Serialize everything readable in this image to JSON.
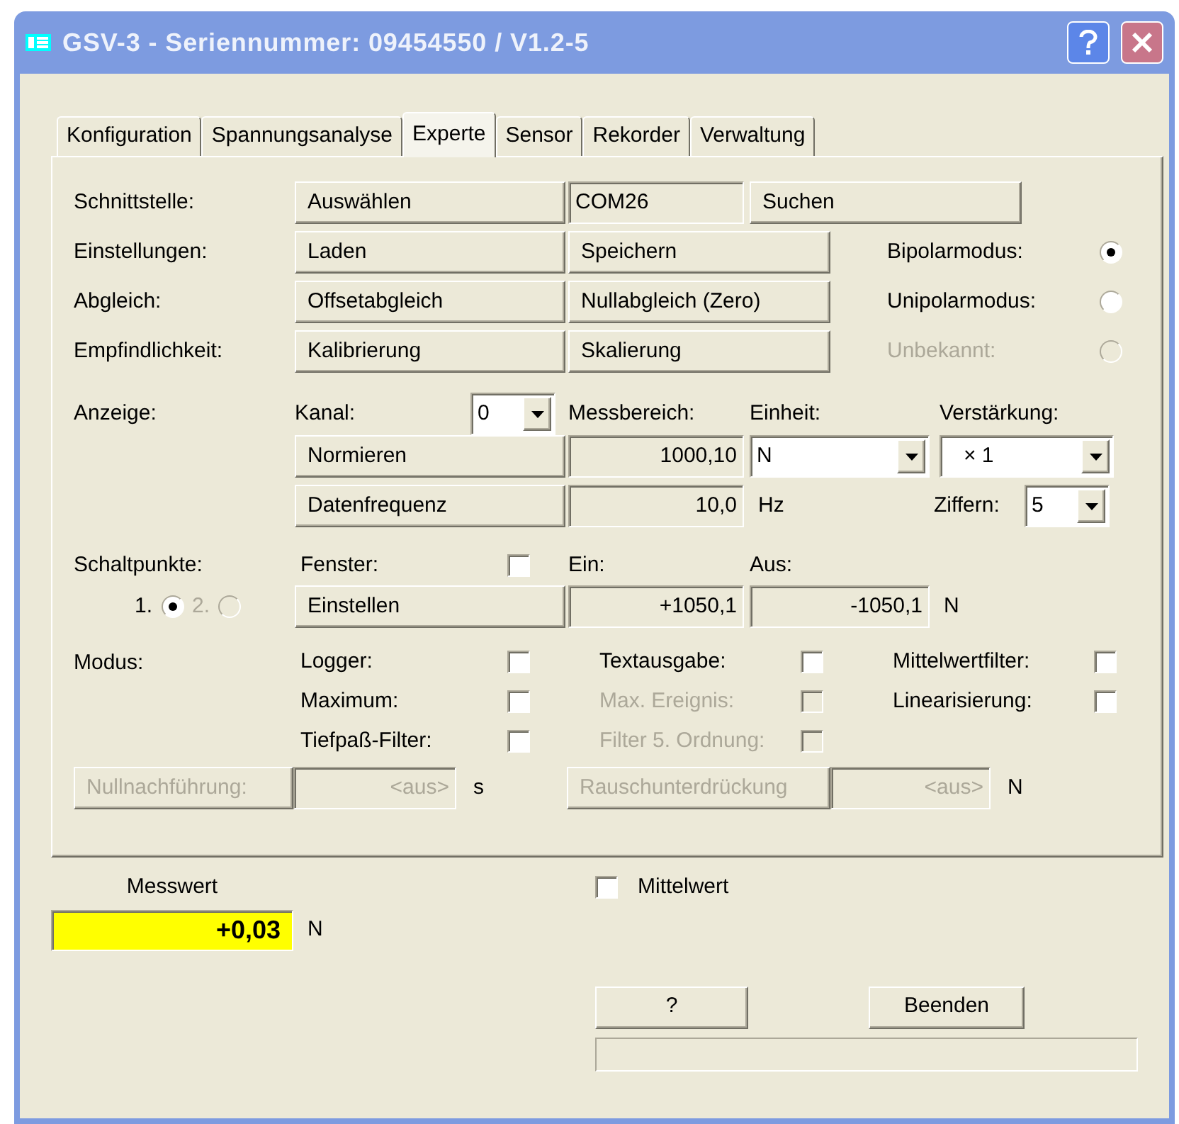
{
  "window": {
    "title": "GSV-3 - Seriennummer: 09454550 / V1.2-5"
  },
  "tabs": [
    {
      "label": "Konfiguration",
      "selected": false
    },
    {
      "label": "Spannungsanalyse",
      "selected": false
    },
    {
      "label": "Experte",
      "selected": true
    },
    {
      "label": "Sensor",
      "selected": false
    },
    {
      "label": "Rekorder",
      "selected": false
    },
    {
      "label": "Verwaltung",
      "selected": false
    }
  ],
  "interface": {
    "label": "Schnittstelle:",
    "select_button": "Auswählen",
    "port": "COM26",
    "search_button": "Suchen"
  },
  "button_rows": [
    {
      "label": "Einstellungen:",
      "buttons": [
        "Laden",
        "Speichern"
      ]
    },
    {
      "label": "Abgleich:",
      "buttons": [
        "Offsetabgleich",
        "Nullabgleich (Zero)"
      ]
    },
    {
      "label": "Empfindlichkeit:",
      "buttons": [
        "Kalibrierung",
        "Skalierung"
      ]
    }
  ],
  "modes": [
    {
      "label": "Bipolarmodus:",
      "selected": true,
      "disabled": false
    },
    {
      "label": "Unipolarmodus:",
      "selected": false,
      "disabled": false
    },
    {
      "label": "Unbekannt:",
      "selected": false,
      "disabled": true
    }
  ],
  "display": {
    "label": "Anzeige:",
    "channel_label": "Kanal:",
    "channel": "0",
    "range_label": "Messbereich:",
    "unit_label": "Einheit:",
    "gain_label": "Verstärkung:",
    "normalize_button": "Normieren",
    "range": "1000,10",
    "unit": "N",
    "gain": "× 1",
    "rate_button": "Datenfrequenz",
    "rate": "10,0",
    "rate_unit": "Hz",
    "digits_label": "Ziffern:",
    "digits": "5"
  },
  "switch_points": {
    "label": "Schaltpunkte:",
    "window_label": "Fenster:",
    "window_checked": false,
    "on_label": "Ein:",
    "off_label": "Aus:",
    "set_button": "Einstellen",
    "on": "+1050,1",
    "off": "-1050,1",
    "unit": "N",
    "points": [
      {
        "label": "1.",
        "selected": true,
        "disabled": false
      },
      {
        "label": "2.",
        "selected": false,
        "disabled": true
      }
    ]
  },
  "mode": {
    "label": "Modus:",
    "columns": [
      [
        {
          "label": "Logger:",
          "checked": false,
          "disabled": false
        },
        {
          "label": "Maximum:",
          "checked": false,
          "disabled": false
        },
        {
          "label": "Tiefpaß-Filter:",
          "checked": false,
          "disabled": false
        }
      ],
      [
        {
          "label": "Textausgabe:",
          "checked": false,
          "disabled": false
        },
        {
          "label": "Max. Ereignis:",
          "checked": false,
          "disabled": true
        },
        {
          "label": "Filter 5. Ordnung:",
          "checked": false,
          "disabled": true
        }
      ],
      [
        {
          "label": "Mittelwertfilter:",
          "checked": false,
          "disabled": false
        },
        {
          "label": "Linearisierung:",
          "checked": false,
          "disabled": false
        }
      ]
    ]
  },
  "tracking": [
    {
      "button": "Nullnachführung:",
      "value": "<aus>",
      "unit": "s",
      "disabled": true
    },
    {
      "button": "Rauschunterdrückung",
      "value": "<aus>",
      "unit": "N",
      "disabled": true
    }
  ],
  "measurement": {
    "label": "Messwert",
    "value": "+0,03",
    "unit": "N"
  },
  "average": {
    "label": "Mittelwert",
    "checked": false
  },
  "buttons": [
    "?",
    "Beenden"
  ]
}
